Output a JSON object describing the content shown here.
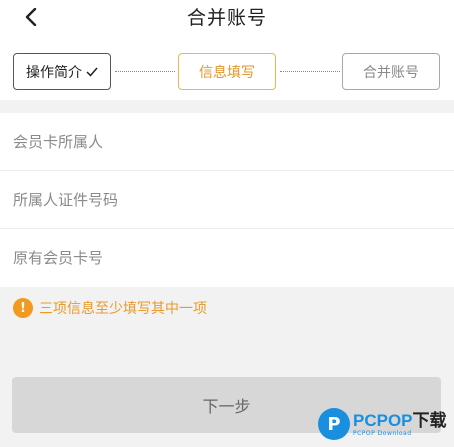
{
  "header": {
    "title": "合并账号",
    "back_icon": "chevron-left-icon"
  },
  "steps": [
    {
      "label": "操作简介",
      "state": "completed"
    },
    {
      "label": "信息填写",
      "state": "active"
    },
    {
      "label": "合并账号",
      "state": "pending"
    }
  ],
  "form": {
    "fields": [
      {
        "placeholder": "会员卡所属人",
        "value": ""
      },
      {
        "placeholder": "所属人证件号码",
        "value": ""
      },
      {
        "placeholder": "原有会员卡号",
        "value": ""
      }
    ]
  },
  "notice": {
    "icon": "!",
    "text": "三项信息至少填写其中一项"
  },
  "next_button": {
    "label": "下一步"
  },
  "watermark": {
    "logo_letter": "P",
    "brand": "PCPOP",
    "brand_cn": "下载",
    "sub": "PCPOP Download"
  },
  "colors": {
    "accent": "#f2b54a",
    "notice": "#f29a1f",
    "disabled_button": "#d7d7d7"
  }
}
